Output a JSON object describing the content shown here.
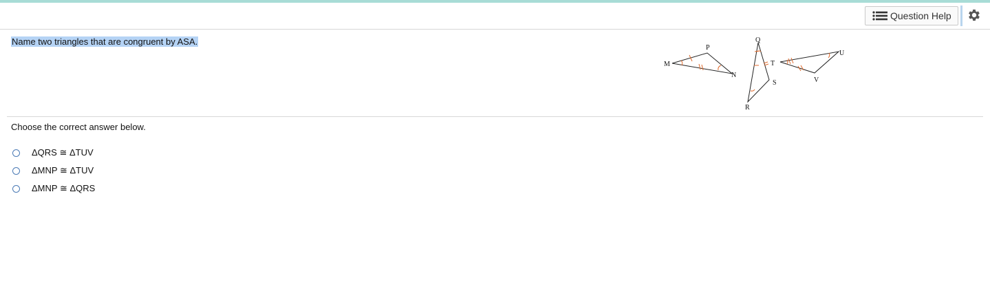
{
  "toolbar": {
    "help_label": "Question Help",
    "help_icon": "list-icon",
    "settings_icon": "gear-icon"
  },
  "question": {
    "text": "Name two triangles that are congruent by ASA."
  },
  "figure": {
    "labels": {
      "M": "M",
      "P": "P",
      "N": "N",
      "Q": "Q",
      "R": "R",
      "S": "S",
      "T": "T",
      "U": "U",
      "V": "V"
    },
    "line_color": "#222222",
    "mark_color": "#e06a2c"
  },
  "prompt": "Choose the correct answer below.",
  "options": [
    {
      "label": "ΔQRS ≅ ΔTUV"
    },
    {
      "label": "ΔMNP ≅ ΔTUV"
    },
    {
      "label": "ΔMNP ≅ ΔQRS"
    }
  ],
  "colors": {
    "accent_strip": "#a8dcd6",
    "selection": "#b5d3f5",
    "radio_border": "#4a7ab5"
  }
}
